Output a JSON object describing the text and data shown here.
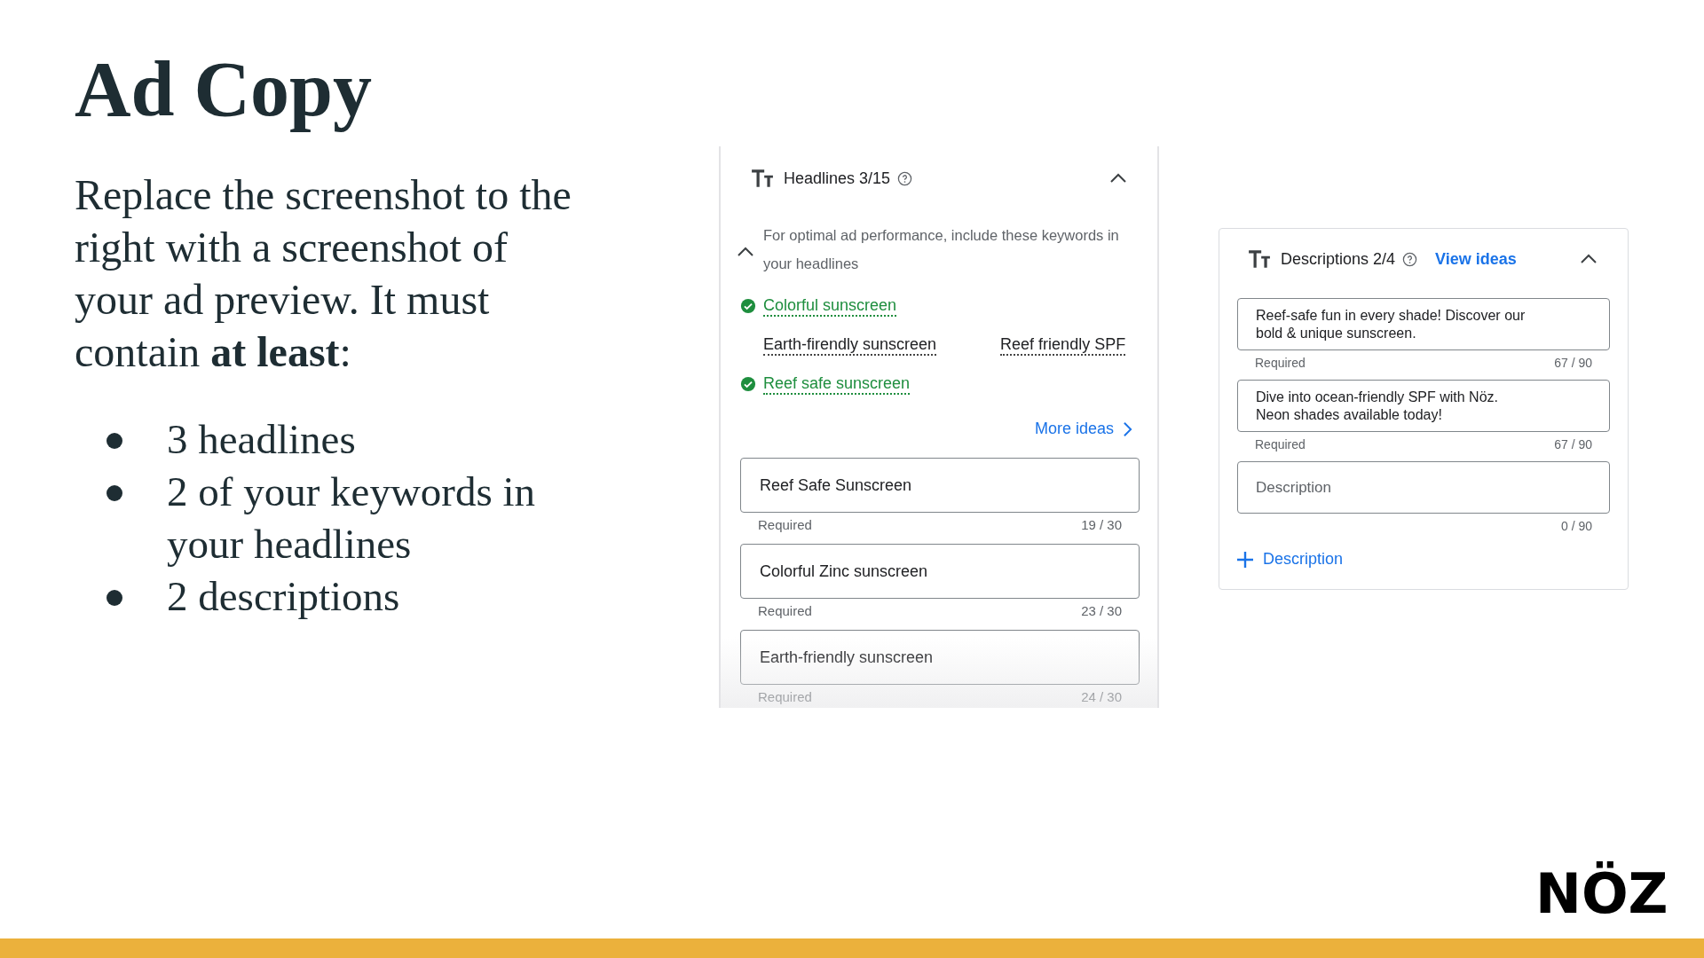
{
  "slide": {
    "title": "Ad Copy",
    "intro": "Replace the screenshot to the right with a screenshot of your ad preview. It must contain **at least**:",
    "bullets": [
      "3 headlines",
      "2 of your keywords in your headlines",
      "2 descriptions"
    ]
  },
  "headlines_panel": {
    "title": "Headlines 3/15",
    "keyword_hint": "For optimal ad performance, include these keywords in your headlines",
    "keywords": [
      {
        "label": "Colorful sunscreen",
        "checked": true
      },
      {
        "label": "Earth-firendly sunscreen",
        "checked": false
      },
      {
        "label": "Reef friendly SPF",
        "checked": false
      },
      {
        "label": "Reef safe sunscreen",
        "checked": true
      }
    ],
    "more_ideas": "More ideas",
    "fields": [
      {
        "value": "Reef Safe Sunscreen",
        "helper": "Required",
        "count": "19 / 30"
      },
      {
        "value": "Colorful Zinc sunscreen",
        "helper": "Required",
        "count": "23 / 30"
      },
      {
        "value": "Earth-friendly sunscreen",
        "helper": "Required",
        "count": "24 / 30"
      }
    ]
  },
  "descriptions_panel": {
    "title": "Descriptions 2/4",
    "view_ideas": "View ideas",
    "fields": [
      {
        "value": "Reef-safe fun in every shade! Discover our\nbold & unique sunscreen.",
        "helper": "Required",
        "count": "67 / 90"
      },
      {
        "value": "Dive into ocean-friendly SPF with Nöz.\nNeon shades available today!",
        "helper": "Required",
        "count": "67 / 90"
      },
      {
        "placeholder": "Description",
        "count": "0 / 90"
      }
    ],
    "add_button": "Description"
  },
  "logo": {
    "text": "NÖZ"
  }
}
